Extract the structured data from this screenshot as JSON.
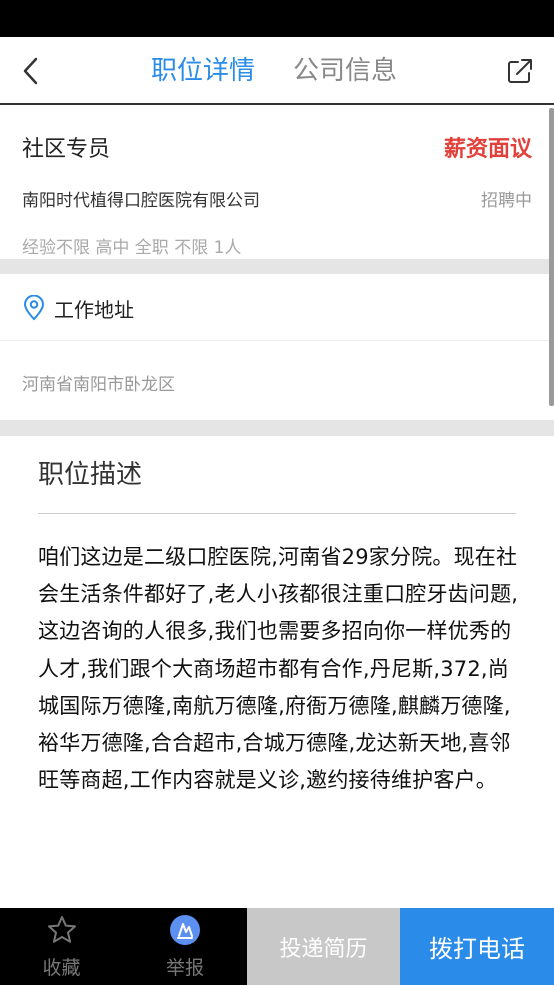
{
  "nav": {
    "tabs": [
      {
        "label": "职位详情",
        "active": true
      },
      {
        "label": "公司信息",
        "active": false
      }
    ],
    "back_icon": "chevron-left-icon",
    "share_icon": "share-icon"
  },
  "job": {
    "title": "社区专员",
    "salary": "薪资面议",
    "company": "南阳时代植得口腔医院有限公司",
    "status": "招聘中",
    "requirements": "经验不限 高中 全职 不限 1人"
  },
  "address": {
    "label": "工作地址",
    "value": "河南省南阳市卧龙区",
    "icon": "location-pin-icon"
  },
  "description": {
    "title": "职位描述",
    "body": "咱们这边是二级口腔医院,河南省29家分院。现在社会生活条件都好了,老人小孩都很注重口腔牙齿问题,这边咨询的人很多,我们也需要多招向你一样优秀的人才,我们跟个大商场超市都有合作,丹尼斯,372,尚城国际万德隆,南航万德隆,府衙万德隆,麒麟万德隆,裕华万德隆,合合超市,合城万德隆,龙达新天地,喜邻旺等商超,工作内容就是义诊,邀约接待维护客户。"
  },
  "bottom_bar": {
    "favorite_label": "收藏",
    "report_label": "举报",
    "resume_label": "投递简历",
    "call_label": "拨打电话"
  },
  "colors": {
    "accent": "#2a8ce8",
    "salary": "#e2403a",
    "resume_disabled": "#c8c8c8"
  }
}
